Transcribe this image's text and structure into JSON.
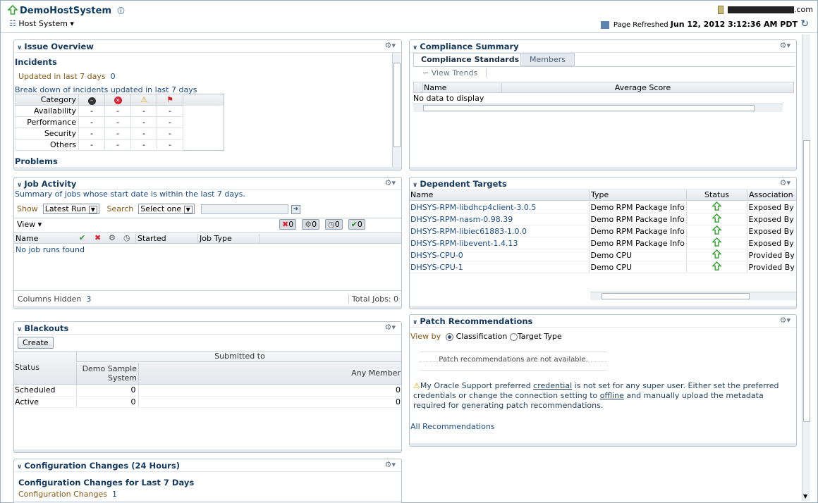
{
  "header": {
    "title": "DemoHostSystem",
    "menu": "Host System",
    "account_suffix": ".com",
    "refresh_label": "Page Refreshed",
    "refresh_time": "Jun 12, 2012 3:12:36 AM PDT"
  },
  "issue": {
    "title": "Issue Overview",
    "incidents": "Incidents",
    "updated": "Updated in last 7 days",
    "updated_count": "0",
    "breakdown": "Break down of incidents updated in last 7 days",
    "col_category": "Category",
    "rows": [
      {
        "label": "Availability",
        "v": [
          "-",
          "-",
          "-",
          "-"
        ]
      },
      {
        "label": "Performance",
        "v": [
          "-",
          "-",
          "-",
          "-"
        ]
      },
      {
        "label": "Security",
        "v": [
          "-",
          "-",
          "-",
          "-"
        ]
      },
      {
        "label": "Others",
        "v": [
          "-",
          "-",
          "-",
          "-"
        ]
      }
    ],
    "problems": "Problems"
  },
  "job": {
    "title": "Job Activity",
    "summary": "Summary of jobs whose start date is within the last 7 days.",
    "show": "Show",
    "show_val": "Latest Run",
    "search": "Search",
    "search_val": "Select one",
    "view": "View",
    "counts": [
      "0",
      "0",
      "0",
      "0"
    ],
    "cols": {
      "name": "Name",
      "started": "Started",
      "type": "Job Type"
    },
    "empty": "No job runs found",
    "hidden_label": "Columns Hidden",
    "hidden_count": "3",
    "total": "Total Jobs: 0"
  },
  "blackouts": {
    "title": "Blackouts",
    "create": "Create",
    "submitted": "Submitted to",
    "status": "Status",
    "demo": "Demo Sample System",
    "any": "Any Member",
    "rows": [
      {
        "status": "Scheduled",
        "demo": "0",
        "any": "0"
      },
      {
        "status": "Active",
        "demo": "0",
        "any": "0"
      }
    ]
  },
  "config": {
    "title": "Configuration Changes (24 Hours)",
    "subtitle": "Configuration Changes for Last 7 Days",
    "label": "Configuration Changes",
    "count": "1"
  },
  "compliance": {
    "title": "Compliance Summary",
    "tab1": "Compliance Standards",
    "tab2": "Members",
    "view_trends": "View Trends",
    "col_name": "Name",
    "col_score": "Average Score",
    "empty": "No data to display"
  },
  "dependent": {
    "title": "Dependent Targets",
    "cols": {
      "name": "Name",
      "type": "Type",
      "status": "Status",
      "assoc": "Association"
    },
    "rows": [
      {
        "name": "DHSYS-RPM-libdhcp4client-3.0.5",
        "type": "Demo RPM Package Info",
        "assoc": "Exposed By"
      },
      {
        "name": "DHSYS-RPM-nasm-0.98.39",
        "type": "Demo RPM Package Info",
        "assoc": "Exposed By"
      },
      {
        "name": "DHSYS-RPM-libiec61883-1.0.0",
        "type": "Demo RPM Package Info",
        "assoc": "Exposed By"
      },
      {
        "name": "DHSYS-RPM-libevent-1.4.13",
        "type": "Demo RPM Package Info",
        "assoc": "Exposed By"
      },
      {
        "name": "DHSYS-CPU-0",
        "type": "Demo CPU",
        "assoc": "Provided By"
      },
      {
        "name": "DHSYS-CPU-1",
        "type": "Demo CPU",
        "assoc": "Provided By"
      }
    ]
  },
  "patch": {
    "title": "Patch Recommendations",
    "viewby": "View by",
    "opt1": "Classification",
    "opt2": "Target Type",
    "na": "Patch recommendations are not available.",
    "warn1": "My Oracle Support preferred ",
    "warn_link1": "credential",
    "warn2": " is not set for any super user. Either set the preferred credentials or change the connection setting to ",
    "warn_link2": "offline",
    "warn3": " and manually upload the metadata required for generating patch recommendations.",
    "all": "All Recommendations"
  },
  "colors": {
    "title": "#0e3b63",
    "link": "#1a4b8c",
    "brown": "#8a5a13",
    "up": "#3aa53a"
  }
}
